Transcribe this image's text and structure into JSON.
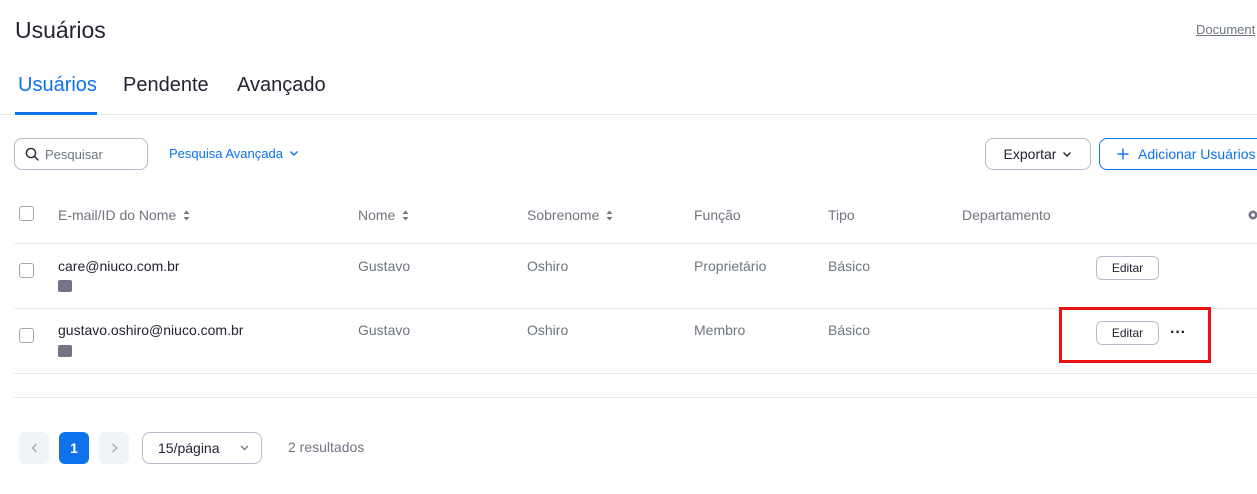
{
  "header": {
    "title": "Usuários",
    "doc_link": "Document"
  },
  "tabs": [
    {
      "label": "Usuários",
      "active": true
    },
    {
      "label": "Pendente",
      "active": false
    },
    {
      "label": "Avançado",
      "active": false
    }
  ],
  "toolbar": {
    "search_placeholder": "Pesquisar",
    "advanced_search": "Pesquisa Avançada",
    "export_label": "Exportar",
    "add_users_label": "Adicionar Usuários"
  },
  "table": {
    "columns": [
      {
        "label": "E-mail/ID do Nome",
        "sortable": true
      },
      {
        "label": "Nome",
        "sortable": true
      },
      {
        "label": "Sobrenome",
        "sortable": true
      },
      {
        "label": "Função",
        "sortable": false
      },
      {
        "label": "Tipo",
        "sortable": false
      },
      {
        "label": "Departamento",
        "sortable": false
      }
    ],
    "rows": [
      {
        "email": "care@niuco.com.br",
        "first_name": "Gustavo",
        "last_name": "Oshiro",
        "role": "Proprietário",
        "type": "Básico",
        "department": "",
        "edit_label": "Editar",
        "more_label": "···"
      },
      {
        "email": "gustavo.oshiro@niuco.com.br",
        "first_name": "Gustavo",
        "last_name": "Oshiro",
        "role": "Membro",
        "type": "Básico",
        "department": "",
        "edit_label": "Editar",
        "more_label": "···"
      }
    ]
  },
  "pagination": {
    "current_page": "1",
    "page_size": "15/página",
    "results": "2 resultados"
  },
  "colors": {
    "accent": "#0e72ed",
    "highlight": "#e81313",
    "text": "#232333",
    "muted": "#6e7680"
  }
}
